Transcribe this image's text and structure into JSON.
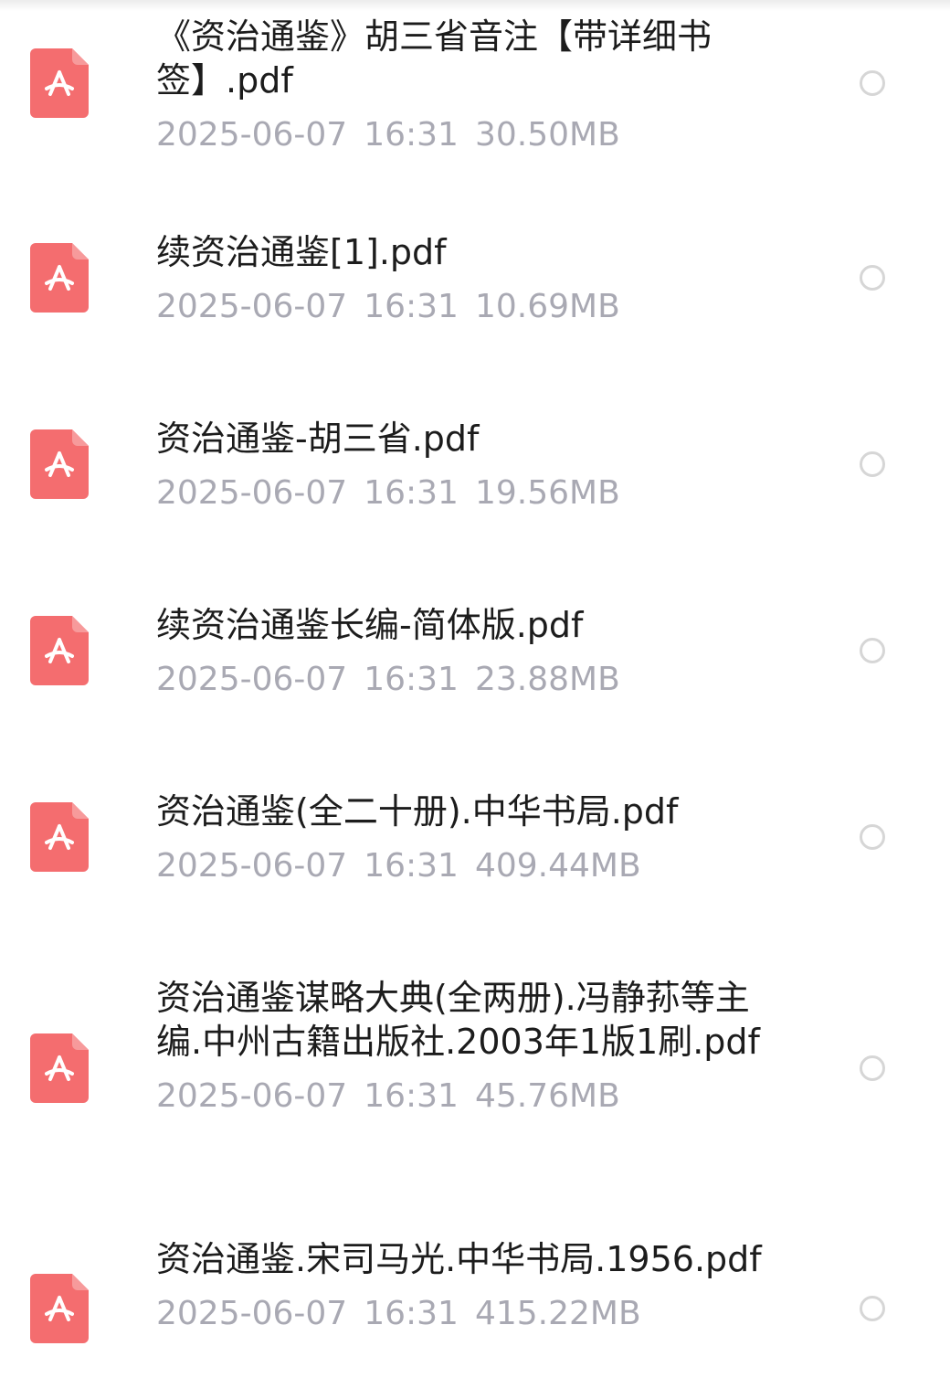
{
  "files": [
    {
      "name": "《资治通鉴》胡三省音注【带详细书签】.pdf",
      "date": "2025-06-07",
      "time": "16:31",
      "size": "30.50MB"
    },
    {
      "name": "续资治通鉴[1].pdf",
      "date": "2025-06-07",
      "time": "16:31",
      "size": "10.69MB"
    },
    {
      "name": "资治通鉴-胡三省.pdf",
      "date": "2025-06-07",
      "time": "16:31",
      "size": "19.56MB"
    },
    {
      "name": "续资治通鉴长编-简体版.pdf",
      "date": "2025-06-07",
      "time": "16:31",
      "size": "23.88MB"
    },
    {
      "name": "资治通鉴(全二十册).中华书局.pdf",
      "date": "2025-06-07",
      "time": "16:31",
      "size": "409.44MB"
    },
    {
      "name": "资治通鉴谋略大典(全两册).冯静荪等主编.中州古籍出版社.2003年1版1刷.pdf",
      "date": "2025-06-07",
      "time": "16:31",
      "size": "45.76MB"
    },
    {
      "name": "资治通鉴.宋司马光.中华书局.1956.pdf",
      "date": "2025-06-07",
      "time": "16:31",
      "size": "415.22MB"
    }
  ],
  "icons": {
    "file_type": "pdf-file-icon",
    "select": "radio-unchecked-icon"
  },
  "colors": {
    "pdf_icon": "#f46d6f",
    "meta_text": "#a9a9b3",
    "radio_border": "#d6d6d6"
  }
}
